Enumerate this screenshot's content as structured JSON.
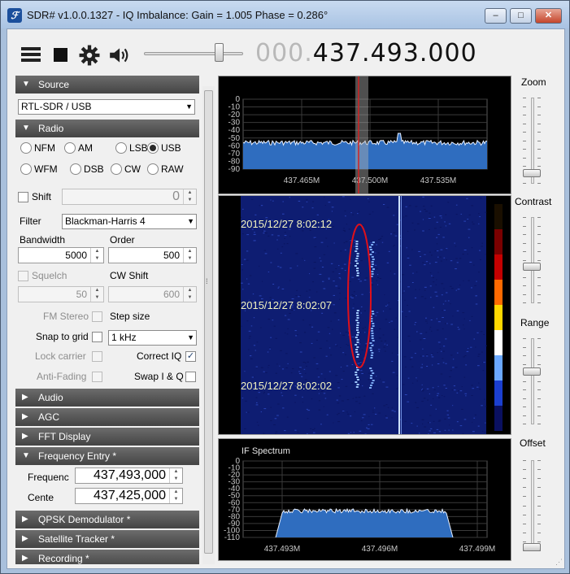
{
  "window": {
    "title": "SDR# v1.0.0.1327 - IQ Imbalance: Gain = 1.005 Phase = 0.286°",
    "min": "–",
    "max": "□",
    "close": "✕"
  },
  "toolbar": {
    "menu_icon": "hamburger-icon",
    "stop_icon": "stop-icon",
    "settings_icon": "gear-icon",
    "volume_icon": "speaker-icon",
    "freq_dim": "000.",
    "freq_main": "437.493.000",
    "volume_level": 0.79
  },
  "source": {
    "header": "Source",
    "device": "RTL-SDR / USB"
  },
  "radio": {
    "header": "Radio",
    "modes": [
      {
        "label": "NFM",
        "selected": false
      },
      {
        "label": "AM",
        "selected": false
      },
      {
        "label": "LSB",
        "selected": false
      },
      {
        "label": "USB",
        "selected": true
      },
      {
        "label": "WFM",
        "selected": false
      },
      {
        "label": "DSB",
        "selected": false
      },
      {
        "label": "CW",
        "selected": false
      },
      {
        "label": "RAW",
        "selected": false
      }
    ],
    "shift_label": "Shift",
    "shift_value": "0",
    "filter_label": "Filter",
    "filter_value": "Blackman-Harris 4",
    "bandwidth_label": "Bandwidth",
    "bandwidth_value": "5000",
    "order_label": "Order",
    "order_value": "500",
    "squelch_label": "Squelch",
    "squelch_value": "50",
    "cwshift_label": "CW Shift",
    "cwshift_value": "600",
    "fmstereo_label": "FM Stereo",
    "stepsize_label": "Step size",
    "snap_label": "Snap to grid",
    "step_value": "1 kHz",
    "lockcarrier_label": "Lock carrier",
    "correctiq_label": "Correct IQ",
    "antifading_label": "Anti-Fading",
    "swapiq_label": "Swap I & Q",
    "check": "✓"
  },
  "sections": {
    "audio": "Audio",
    "agc": "AGC",
    "fft": "FFT Display",
    "freqentry": "Frequency Entry *",
    "qpsk": "QPSK Demodulator *",
    "sattrack": "Satellite Tracker *",
    "recording": "Recording *"
  },
  "freqentry": {
    "freq_label": "Frequenc",
    "freq_value": "437,493,000",
    "center_label": "Cente",
    "center_value": "437,425,000"
  },
  "arrows": {
    "expanded": "▼",
    "collapsed": "▶",
    "dropdown": "▼",
    "up": "▲",
    "down": "▼"
  },
  "spectrum": {
    "y_ticks": [
      "0",
      "-10",
      "-20",
      "-30",
      "-40",
      "-50",
      "-60",
      "-70",
      "-80",
      "-90"
    ],
    "x_ticks": [
      "437.465M",
      "437.500M",
      "437.535M"
    ]
  },
  "waterfall": {
    "timestamps": [
      "2015/12/27 8:02:12",
      "2015/12/27 8:02:07",
      "2015/12/27 8:02:02"
    ]
  },
  "ifspectrum": {
    "title": "IF Spectrum",
    "y_ticks": [
      "0",
      "-10",
      "-20",
      "-30",
      "-40",
      "-50",
      "-60",
      "-70",
      "-80",
      "-90",
      "-100",
      "-110"
    ],
    "x_ticks": [
      "437.493M",
      "437.496M",
      "437.499M"
    ]
  },
  "sliders": {
    "zoom": "Zoom",
    "contrast": "Contrast",
    "range": "Range",
    "offset": "Offset",
    "zoom_level": 0.08,
    "contrast_level": 0.42,
    "range_level": 0.62,
    "offset_level": 0.0
  },
  "splitter_glyph": "⁞",
  "grip_glyph": "⋰",
  "colors": {
    "header_bg": "#4f4f4f",
    "waterfall_bg": "#0d1a6a",
    "trace": "#e8f0ff",
    "fill": "#3a78c8",
    "tuner": "#d42020",
    "annotation": "#e0101a"
  }
}
